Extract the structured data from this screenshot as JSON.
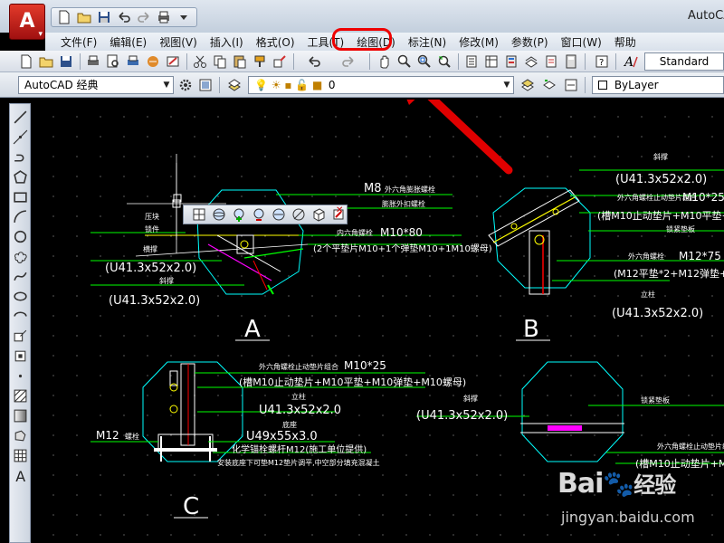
{
  "window": {
    "title": "AutoCAD",
    "logo_letter": "A"
  },
  "menu": [
    {
      "label": "文件(F)"
    },
    {
      "label": "编辑(E)"
    },
    {
      "label": "视图(V)"
    },
    {
      "label": "插入(I)"
    },
    {
      "label": "格式(O)"
    },
    {
      "label": "工具(T)"
    },
    {
      "label": "绘图(D)"
    },
    {
      "label": "标注(N)"
    },
    {
      "label": "修改(M)"
    },
    {
      "label": "参数(P)"
    },
    {
      "label": "窗口(W)"
    },
    {
      "label": "帮助"
    }
  ],
  "highlighted_menu": "工具(T)",
  "toolbar": {
    "text_style": "Standard",
    "workspace": "AutoCAD 经典",
    "layer": "0",
    "color": "ByLayer"
  },
  "colors": {
    "highlight": "#e00000",
    "cad_cyan": "#00ffff",
    "cad_green": "#00ff00",
    "cad_yellow": "#ffff00",
    "cad_magenta": "#ff00ff",
    "cad_red": "#ff0000",
    "canvas": "#000000"
  },
  "drawing": {
    "details": {
      "a": "A",
      "b": "B",
      "c": "C"
    },
    "annotations": {
      "a_m8": "M8",
      "a_m8_desc": "外六角膨胀螺栓",
      "a_m8_sub": "膨胀外扣螺栓",
      "a_pipe1_label": "压块",
      "a_pipe1_label2": "锁件",
      "a_pipe1_label3": "横撑",
      "a_pipe1": "(U41.3x52x2.0)",
      "a_pipe2_label": "斜撑",
      "a_pipe2": "(U41.3x52x2.0)",
      "a_bolt_label": "内六角螺栓",
      "a_bolt": "M10*80",
      "a_bolt_sub": "(2个平垫片M10+1个弹垫M10+1M10螺母)",
      "b_top_label": "斜撑",
      "b_top": "(U41.3x52x2.0)",
      "b_m10_label": "外六角螺栓止动垫片组合",
      "b_m10": "M10*25",
      "b_m10_sub": "(槽M10止动垫片+M10平垫+M10",
      "b_clamp": "锁紧垫板",
      "b_m12_label": "外六角螺栓",
      "b_m12": "M12*75",
      "b_m12_sub": "(M12平垫*2+M12弹垫+M",
      "b_post_label": "立柱",
      "b_post": "(U41.3x52x2.0)",
      "c_m10_label": "外六角螺栓止动垫片组合",
      "c_m10": "M10*25",
      "c_m10_sub": "(槽M10止动垫片+M10平垫+M10弹垫+M10螺母)",
      "c_post_label": "立柱",
      "c_post": "U41.3x52x2.0",
      "c_base_label": "底座",
      "c_base": "U49x55x3.0",
      "c_m12": "M12",
      "c_m12_label": "螺栓",
      "c_anchor": "化学锚栓螺杆M12(施工单位提供)",
      "c_anchor_sub": "安装底座下可垫M12垫片调平,中空部分填充混凝土",
      "d_brace_label": "斜撑",
      "d_brace": "(U41.3x52x2.0)",
      "d_plate": "锁紧垫板",
      "d_m10_label": "外六角螺栓止动垫片组合",
      "d_m10_sub": "(槽M10止动垫片+M10平"
    }
  },
  "watermark": {
    "brand": "Bai",
    "brand_cn": "经验",
    "url": "jingyan.baidu.com"
  }
}
